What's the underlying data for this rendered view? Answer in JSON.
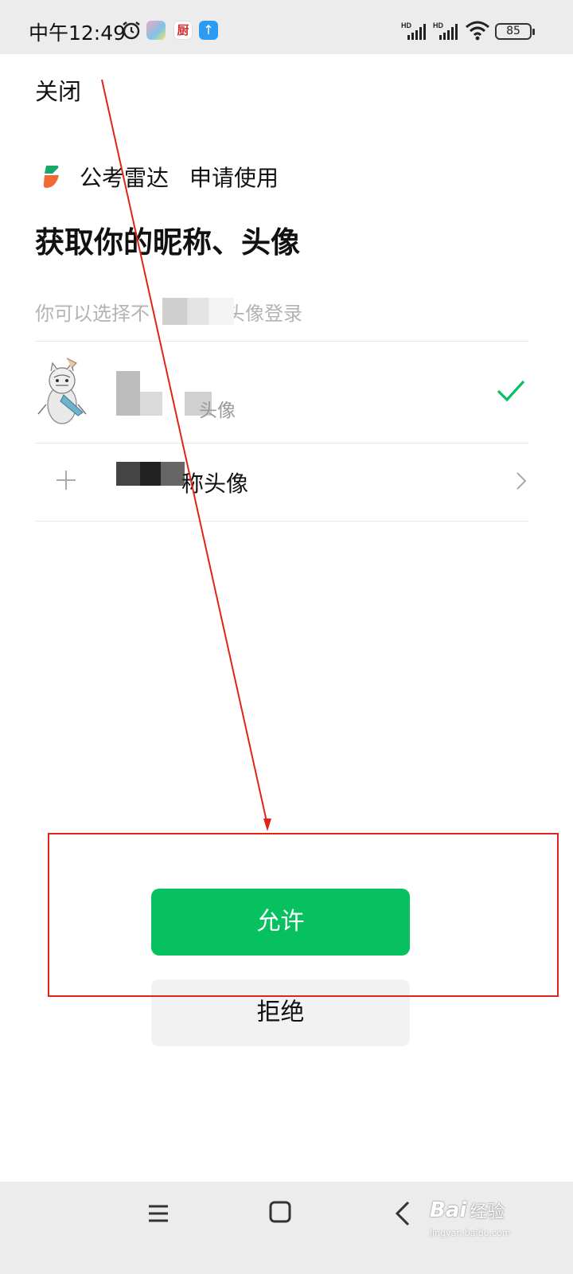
{
  "status_bar": {
    "time": "中午12:49",
    "battery": "85",
    "app_icon_2_text": "厨",
    "app_icon_3_text": "↑"
  },
  "header": {
    "close_label": "关闭"
  },
  "app": {
    "name": "公考雷达",
    "request": "申请使用"
  },
  "title": "获取你的昵称、头像",
  "hint": "你可以选择不　　　、头像登录",
  "options": {
    "current_profile_subtitle": "头像",
    "new_profile_label": "称头像"
  },
  "buttons": {
    "allow": "允许",
    "deny": "拒绝"
  },
  "watermark": {
    "brand": "Bai",
    "brand_suffix": "经验",
    "url": "jingyan.baidu.com"
  },
  "colors": {
    "accent": "#07c160",
    "annotation": "#e2231a"
  },
  "icons": [
    "alarm-icon",
    "wifi-icon",
    "plus-icon",
    "checkmark-icon",
    "chevron-right-icon",
    "menu-icon",
    "home-icon",
    "back-icon"
  ]
}
